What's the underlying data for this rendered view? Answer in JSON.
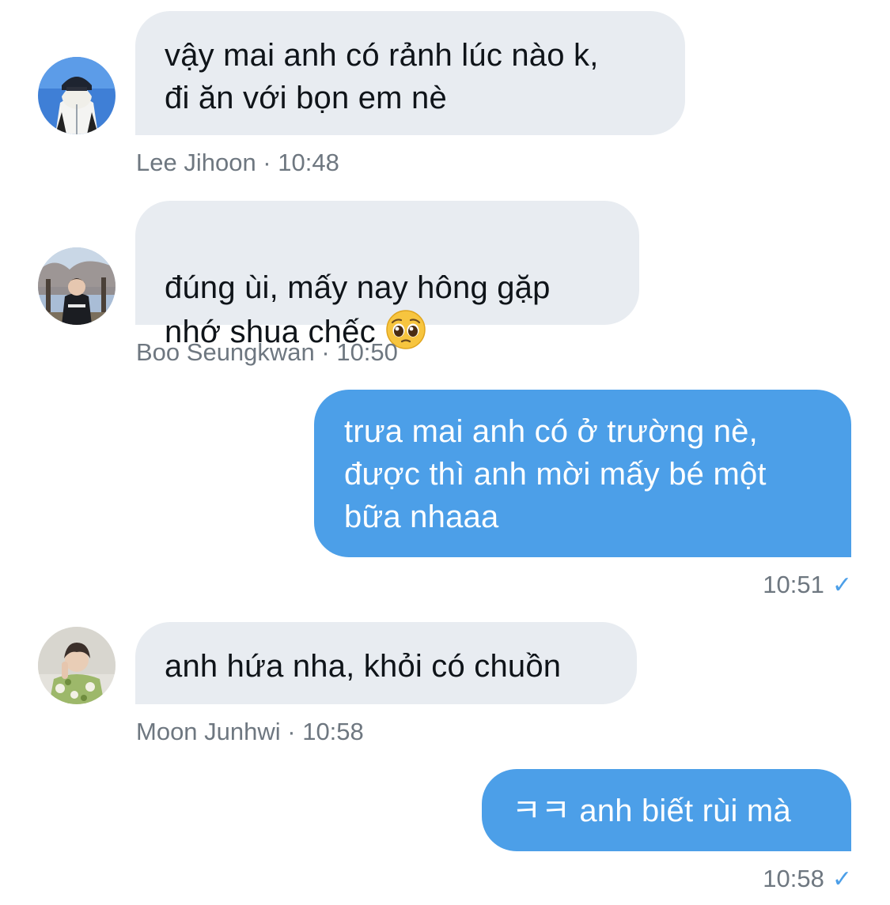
{
  "messages": [
    {
      "sender": "Lee Jihoon",
      "time": "10:48",
      "text": "vậy mai anh có rảnh lúc nào k,\nđi ăn với bọn em nè",
      "meta": "Lee Jihoon · 10:48"
    },
    {
      "sender": "Boo Seungkwan",
      "time": "10:50",
      "text": "đúng ùi, mấy nay hông gặp\nnhớ shua chếc",
      "emoji": "pleading-face",
      "meta": "Boo Seungkwan · 10:50"
    },
    {
      "sender": "me",
      "time": "10:51",
      "text": "trưa mai anh có ở trường nè,\nđược thì anh mời mấy bé một\nbữa nhaaa",
      "meta": "10:51",
      "status": "sent"
    },
    {
      "sender": "Moon Junhwi",
      "time": "10:58",
      "text": "anh hứa nha, khỏi có chuồn",
      "meta": "Moon Junhwi · 10:58"
    },
    {
      "sender": "me",
      "time": "10:58",
      "text": "ㅋㅋ anh biết rùi mà",
      "meta": "10:58",
      "status": "sent"
    }
  ],
  "icons": {
    "sent_check": "✓",
    "read_check_color": "#4c9fe8"
  },
  "colors": {
    "incoming_bubble": "#e8ecf1",
    "outgoing_bubble": "#4c9fe8",
    "meta_text": "#6e7780"
  }
}
